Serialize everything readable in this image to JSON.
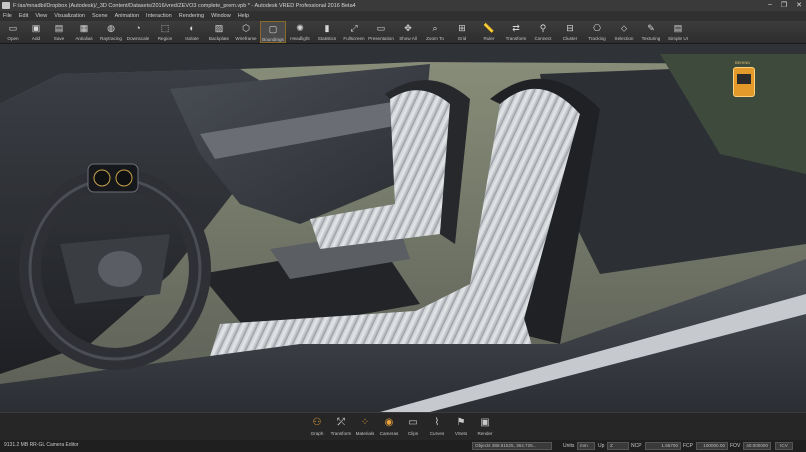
{
  "window": {
    "title": "F:/as/mnadbi/Dropbox (Autodesk)/_3D Content/Datasets/2016/vred/ZEVO3 complete_prem.vpb * - Autodesk VRED Professional 2016 Beta4"
  },
  "window_controls": [
    "–",
    "❐",
    "✕"
  ],
  "menu": [
    "File",
    "Edit",
    "View",
    "Visualization",
    "Scene",
    "Animation",
    "Interaction",
    "Rendering",
    "Window",
    "Help"
  ],
  "toolbar": [
    {
      "label": "Open",
      "icon": "folder-icon",
      "glyph": "▭"
    },
    {
      "label": "Add",
      "icon": "add-icon",
      "glyph": "▣"
    },
    {
      "label": "Save",
      "icon": "save-icon",
      "glyph": "▤"
    },
    {
      "label": "Antialias",
      "icon": "antialias-icon",
      "glyph": "▦"
    },
    {
      "label": "Raytracing",
      "icon": "raytracing-icon",
      "glyph": "◍"
    },
    {
      "label": "Downscale",
      "icon": "downscale-icon",
      "glyph": "◔"
    },
    {
      "label": "Region",
      "icon": "region-icon",
      "glyph": "⬚"
    },
    {
      "label": "Isolate",
      "icon": "isolate-icon",
      "glyph": "◐"
    },
    {
      "label": "Backplate",
      "icon": "backplate-icon",
      "glyph": "▨"
    },
    {
      "label": "Wireframe",
      "icon": "wireframe-icon",
      "glyph": "⬡"
    },
    {
      "label": "Boundings",
      "icon": "boundings-icon",
      "glyph": "▢",
      "active": true
    },
    {
      "label": "Headlight",
      "icon": "headlight-icon",
      "glyph": "✺"
    },
    {
      "label": "Statistics",
      "icon": "statistics-icon",
      "glyph": "▮"
    },
    {
      "label": "Fullscreen",
      "icon": "fullscreen-icon",
      "glyph": "⤢"
    },
    {
      "label": "Presentation",
      "icon": "presentation-icon",
      "glyph": "▭"
    },
    {
      "label": "Show All",
      "icon": "show-all-icon",
      "glyph": "✥"
    },
    {
      "label": "Zoom To",
      "icon": "zoom-to-icon",
      "glyph": "⌕"
    },
    {
      "label": "Grid",
      "icon": "grid-icon",
      "glyph": "⊞"
    },
    {
      "label": "Ruler",
      "icon": "ruler-icon",
      "glyph": "📏"
    },
    {
      "label": "Transform",
      "icon": "transform-icon",
      "glyph": "⇄"
    },
    {
      "label": "Connect",
      "icon": "connect-icon",
      "glyph": "⚲"
    },
    {
      "label": "Cluster",
      "icon": "cluster-icon",
      "glyph": "⊟"
    },
    {
      "label": "Tracking",
      "icon": "tracking-icon",
      "glyph": "⎔"
    },
    {
      "label": "Selection",
      "icon": "selection-icon",
      "glyph": "⬦"
    },
    {
      "label": "Texturing",
      "icon": "texturing-icon",
      "glyph": "✎"
    },
    {
      "label": "Simple UI",
      "icon": "simple-ui-icon",
      "glyph": "▤"
    }
  ],
  "viewcube": {
    "label": "BEHIND"
  },
  "dock": [
    {
      "label": "Graph",
      "icon": "graph-icon",
      "glyph": "⚇",
      "grey": false
    },
    {
      "label": "Transform",
      "icon": "transform-editor-icon",
      "glyph": "⤱",
      "grey": true
    },
    {
      "label": "Materials",
      "icon": "materials-icon",
      "glyph": "⁘",
      "grey": false
    },
    {
      "label": "Cameras",
      "icon": "cameras-icon",
      "glyph": "◉",
      "grey": false
    },
    {
      "label": "Clips",
      "icon": "clips-icon",
      "glyph": "▭",
      "grey": true
    },
    {
      "label": "Curves",
      "icon": "curves-icon",
      "glyph": "⌇",
      "grey": true
    },
    {
      "label": "VSets",
      "icon": "vsets-icon",
      "glyph": "⚑",
      "grey": true
    },
    {
      "label": "Render",
      "icon": "render-icon",
      "glyph": "▣",
      "grey": true
    }
  ],
  "status": {
    "left": "9131.2 MB  RR-GL  Camera Editor",
    "coords": "Objects 388.81525, 364.726...",
    "units_label": "Units",
    "units_value": "mm",
    "up_label": "Up",
    "up_value": "Z",
    "ncp_label": "NCP",
    "ncp_value": "1.65700",
    "fcp_label": "FCP",
    "fcp_value": "100000.00",
    "fov_label": "FOV",
    "fov_value": "40.000000",
    "icv": "ICV"
  }
}
